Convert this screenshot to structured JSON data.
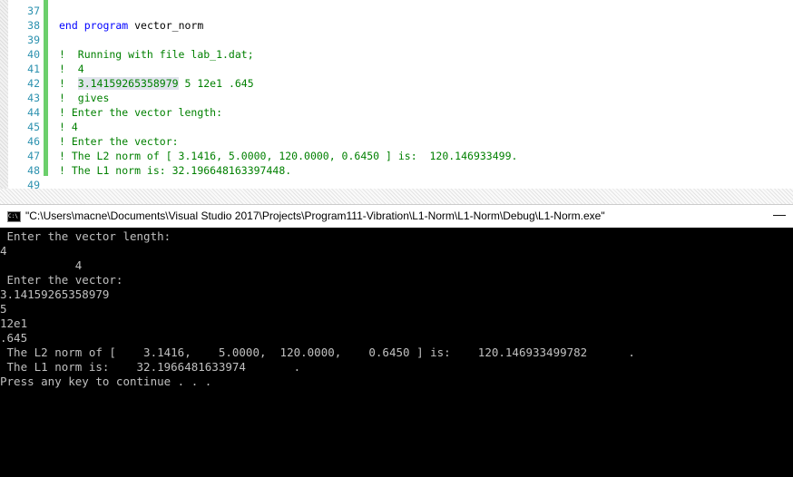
{
  "editor": {
    "lines": [
      {
        "n": "37",
        "text": ""
      },
      {
        "n": "38",
        "kw1": "end",
        "kw2": "program",
        "name": "vector_norm"
      },
      {
        "n": "39",
        "text": ""
      },
      {
        "n": "40",
        "text": "!  Running with file lab_1.dat;"
      },
      {
        "n": "41",
        "text": "!  4"
      },
      {
        "n": "42",
        "prefix": "!  ",
        "highlight": "3.14159265358979",
        "rest": " 5 12e1 .645"
      },
      {
        "n": "43",
        "text": "!  gives"
      },
      {
        "n": "44",
        "text": "! Enter the vector length:"
      },
      {
        "n": "45",
        "text": "! 4"
      },
      {
        "n": "46",
        "text": "! Enter the vector:"
      },
      {
        "n": "47",
        "text": "! The L2 norm of [ 3.1416, 5.0000, 120.0000, 0.6450 ] is:  120.146933499."
      },
      {
        "n": "48",
        "text": "! The L1 norm is: 32.196648163397448."
      },
      {
        "n": "49",
        "text": ""
      }
    ]
  },
  "console": {
    "title": "\"C:\\Users\\macne\\Documents\\Visual Studio 2017\\Projects\\Program111-Vibration\\L1-Norm\\L1-Norm\\Debug\\L1-Norm.exe\"",
    "minimize": "—",
    "icon_text": "C:\\",
    "lines": [
      " Enter the vector length:",
      "4",
      "           4",
      " Enter the vector:",
      "3.14159265358979",
      "5",
      "12e1",
      ".645",
      " The L2 norm of [    3.1416,    5.0000,  120.0000,    0.6450 ] is:    120.146933499782      .",
      " The L1 norm is:    32.1966481633974       .",
      "Press any key to continue . . ."
    ]
  }
}
